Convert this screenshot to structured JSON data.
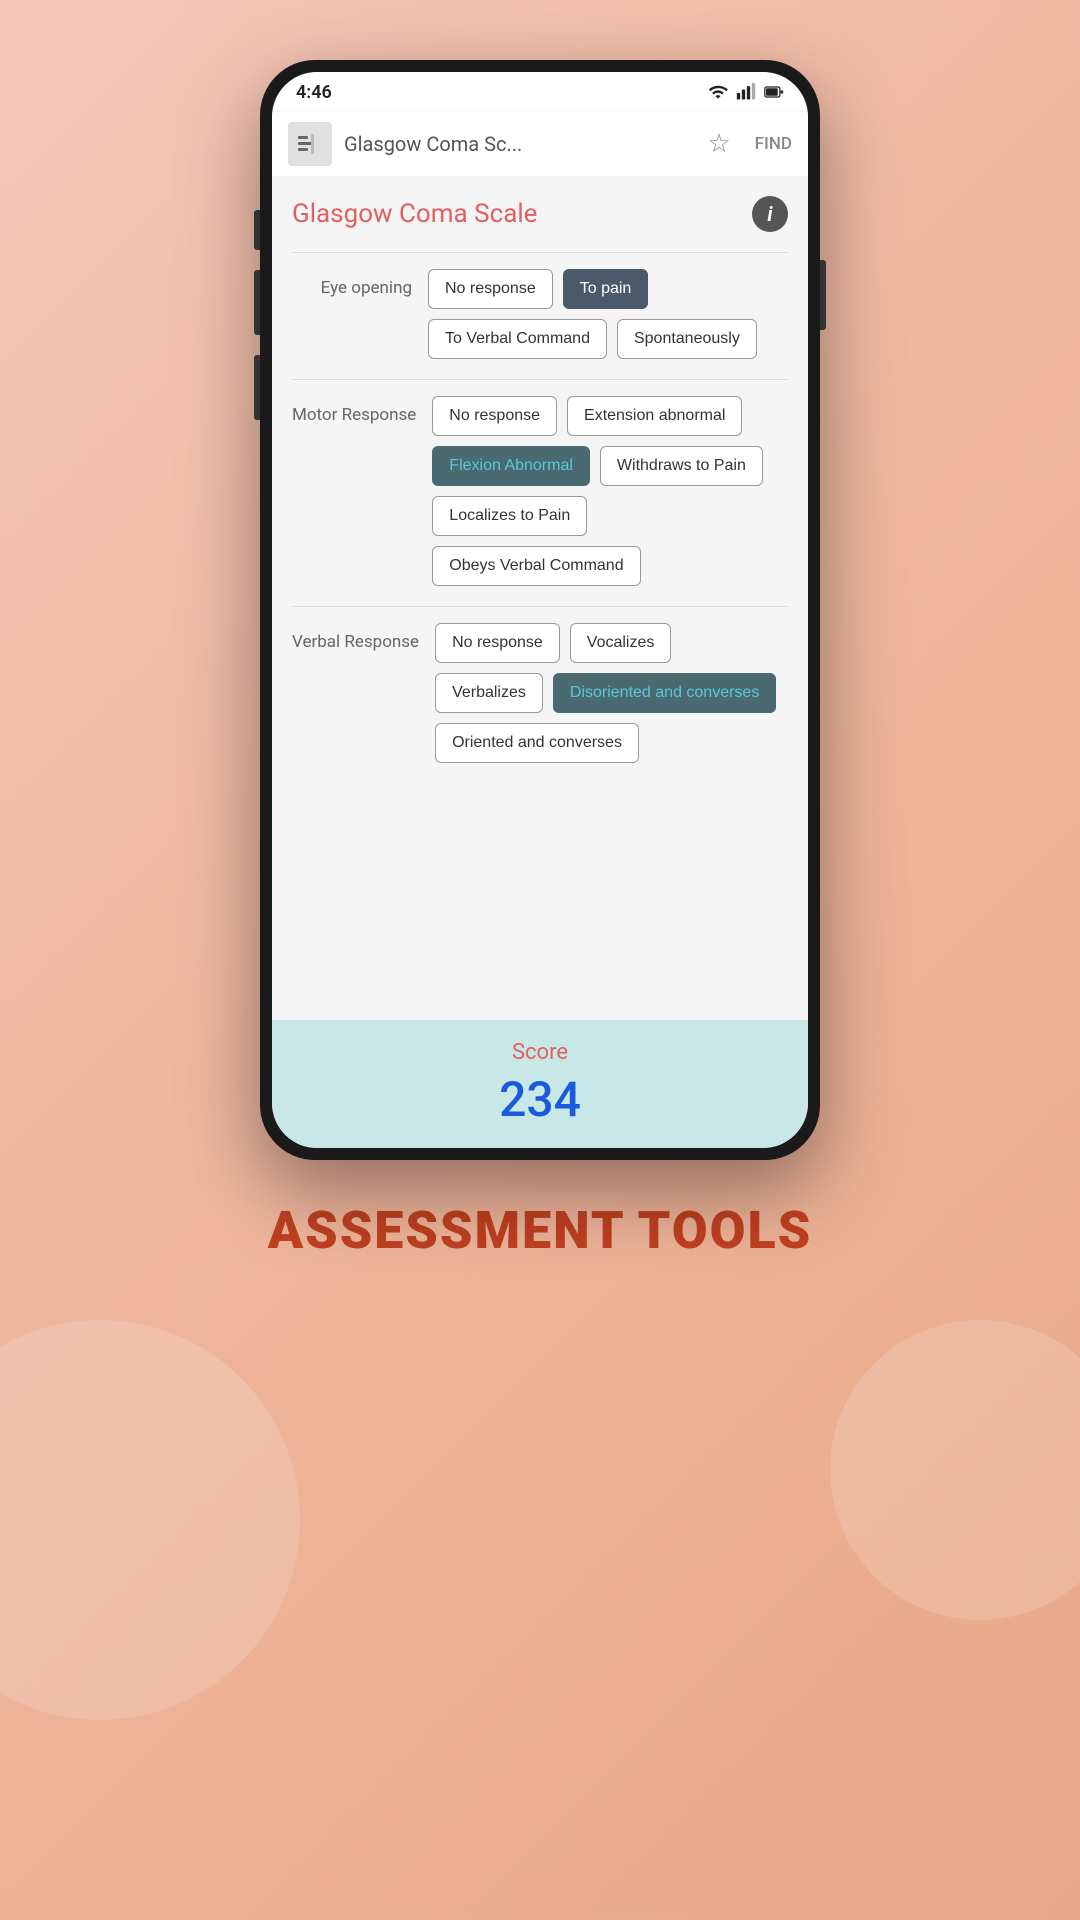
{
  "status_bar": {
    "time": "4:46"
  },
  "app_bar": {
    "title": "Glasgow Coma Sc...",
    "find_label": "FIND"
  },
  "page": {
    "title": "Glasgow Coma Scale"
  },
  "eye_opening": {
    "label": "Eye opening",
    "options": [
      {
        "text": "No response",
        "selected": false
      },
      {
        "text": "To pain",
        "selected": true,
        "style": "dark"
      },
      {
        "text": "To Verbal Command",
        "selected": false
      },
      {
        "text": "Spontaneously",
        "selected": false
      }
    ]
  },
  "motor_response": {
    "label": "Motor Response",
    "options": [
      {
        "text": "No response",
        "selected": false
      },
      {
        "text": "Extension abnormal",
        "selected": false
      },
      {
        "text": "Flexion Abnormal",
        "selected": true,
        "style": "teal"
      },
      {
        "text": "Withdraws to Pain",
        "selected": false
      },
      {
        "text": "Localizes to Pain",
        "selected": false
      },
      {
        "text": "Obeys Verbal Command",
        "selected": false
      }
    ]
  },
  "verbal_response": {
    "label": "Verbal Response",
    "options": [
      {
        "text": "No response",
        "selected": false
      },
      {
        "text": "Vocalizes",
        "selected": false
      },
      {
        "text": "Verbalizes",
        "selected": false
      },
      {
        "text": "Disoriented and converses",
        "selected": true,
        "style": "teal"
      },
      {
        "text": "Oriented and converses",
        "selected": false
      }
    ]
  },
  "score": {
    "label": "Score",
    "value": "234"
  },
  "footer": {
    "title": "ASSESSMENT TOOLS"
  }
}
